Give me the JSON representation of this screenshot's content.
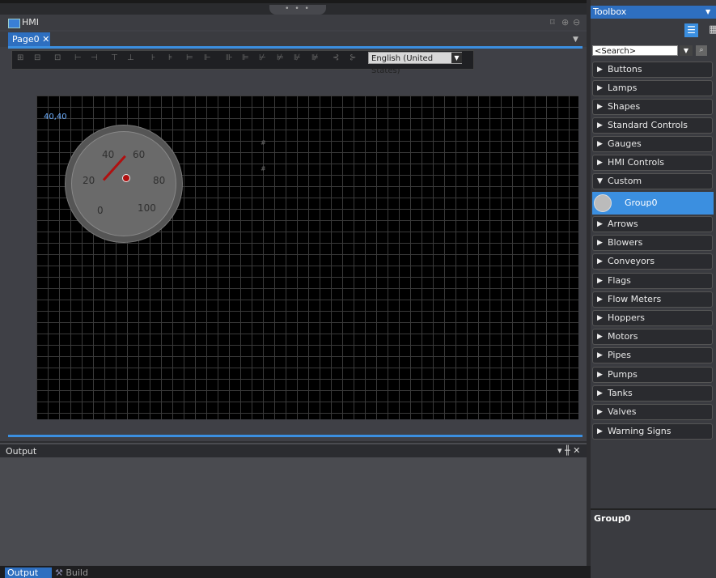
{
  "hmi": {
    "title": "HMI",
    "grip": "• • •",
    "tools": [
      "⌑",
      "⊕",
      "⊖"
    ],
    "tab": "Page0 ✕",
    "toolbar_icons": [
      "⊞",
      "⊟",
      "⊡",
      "⊢",
      "⊣",
      "⊤",
      "⊥",
      "⊦",
      "⊧",
      "⊨",
      "⊩",
      "⊪",
      "⊫",
      "⊬",
      "⊭",
      "⊮",
      "⊯",
      "⊰",
      "⊱",
      "⊲",
      "⊳"
    ],
    "language": "English (United States)",
    "canvas_coord": "40,40",
    "gauge_labels": [
      "0",
      "20",
      "40",
      "60",
      "80",
      "100"
    ]
  },
  "output": {
    "title": "Output",
    "controls": "▾ ╫ ✕",
    "tab_output": "Output",
    "tab_build": "Build"
  },
  "toolbox": {
    "title": "Toolbox",
    "search_placeholder": "<Search>",
    "categories": [
      {
        "label": "Buttons",
        "open": false
      },
      {
        "label": "Lamps",
        "open": false
      },
      {
        "label": "Shapes",
        "open": false
      },
      {
        "label": "Standard Controls",
        "open": false
      },
      {
        "label": "Gauges",
        "open": false
      },
      {
        "label": "HMI Controls",
        "open": false
      },
      {
        "label": "Custom",
        "open": true
      },
      {
        "label": "Arrows",
        "open": false
      },
      {
        "label": "Blowers",
        "open": false
      },
      {
        "label": "Conveyors",
        "open": false
      },
      {
        "label": "Flags",
        "open": false
      },
      {
        "label": "Flow Meters",
        "open": false
      },
      {
        "label": "Hoppers",
        "open": false
      },
      {
        "label": "Motors",
        "open": false
      },
      {
        "label": "Pipes",
        "open": false
      },
      {
        "label": "Pumps",
        "open": false
      },
      {
        "label": "Tanks",
        "open": false
      },
      {
        "label": "Valves",
        "open": false
      },
      {
        "label": "Warning Signs",
        "open": false
      }
    ],
    "custom_item": "Group0",
    "selected_name": "Group0"
  },
  "colors": {
    "accent": "#3b8fe0",
    "tab": "#2e6fc0",
    "needle": "#b01010"
  }
}
